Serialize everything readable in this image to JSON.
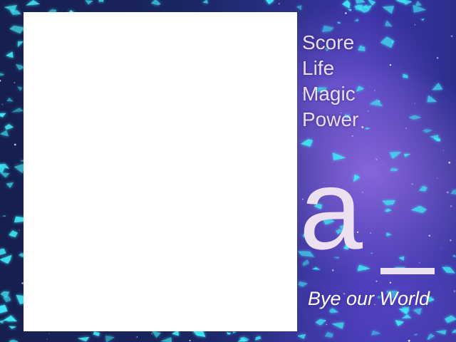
{
  "hud": {
    "labels": [
      "Score",
      "Life",
      "Magic",
      "Power"
    ]
  },
  "logo": {
    "letter": "a"
  },
  "tagline": "Bye our World",
  "colors": {
    "hud_text": "#e7dcf2",
    "logo": "#ecdff0",
    "playfield": "#ffffff",
    "shard": "#3fe6f5",
    "space": "#1b2560"
  }
}
